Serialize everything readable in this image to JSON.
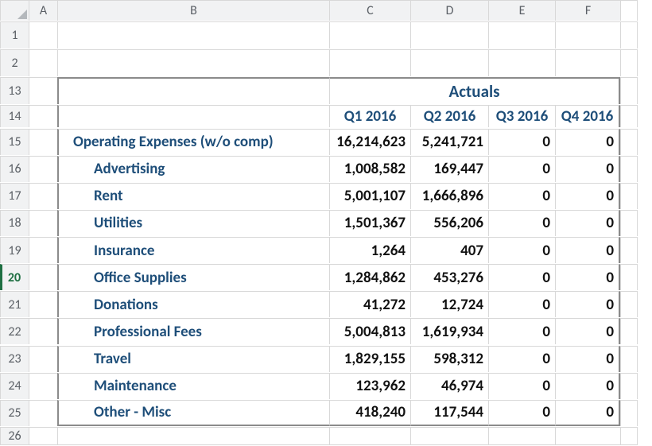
{
  "columns": [
    "A",
    "B",
    "C",
    "D",
    "E",
    "F"
  ],
  "rowNumbers": [
    "1",
    "2",
    "13",
    "14",
    "15",
    "16",
    "17",
    "18",
    "19",
    "20",
    "21",
    "22",
    "23",
    "24",
    "25",
    "26"
  ],
  "activeRow": "20",
  "header": {
    "section": "Actuals",
    "quarters": [
      "Q1 2016",
      "Q2 2016",
      "Q3 2016",
      "Q4 2016"
    ]
  },
  "group": {
    "title": "Operating Expenses (w/o comp)",
    "totals": [
      "16,214,623",
      "5,241,721",
      "0",
      "0"
    ]
  },
  "rows": [
    {
      "label": "Advertising",
      "v": [
        "1,008,582",
        "169,447",
        "0",
        "0"
      ]
    },
    {
      "label": "Rent",
      "v": [
        "5,001,107",
        "1,666,896",
        "0",
        "0"
      ]
    },
    {
      "label": "Utilities",
      "v": [
        "1,501,367",
        "556,206",
        "0",
        "0"
      ]
    },
    {
      "label": "Insurance",
      "v": [
        "1,264",
        "407",
        "0",
        "0"
      ]
    },
    {
      "label": "Office Supplies",
      "v": [
        "1,284,862",
        "453,276",
        "0",
        "0"
      ]
    },
    {
      "label": "Donations",
      "v": [
        "41,272",
        "12,724",
        "0",
        "0"
      ]
    },
    {
      "label": "Professional Fees",
      "v": [
        "5,004,813",
        "1,619,934",
        "0",
        "0"
      ]
    },
    {
      "label": "Travel",
      "v": [
        "1,829,155",
        "598,312",
        "0",
        "0"
      ]
    },
    {
      "label": "Maintenance",
      "v": [
        "123,962",
        "46,974",
        "0",
        "0"
      ]
    },
    {
      "label": "Other - Misc",
      "v": [
        "418,240",
        "117,544",
        "0",
        "0"
      ]
    }
  ],
  "chart_data": {
    "type": "table",
    "title": "Actuals — Operating Expenses (w/o comp)",
    "categories": [
      "Q1 2016",
      "Q2 2016",
      "Q3 2016",
      "Q4 2016"
    ],
    "series": [
      {
        "name": "Operating Expenses (w/o comp)",
        "values": [
          16214623,
          5241721,
          0,
          0
        ]
      },
      {
        "name": "Advertising",
        "values": [
          1008582,
          169447,
          0,
          0
        ]
      },
      {
        "name": "Rent",
        "values": [
          5001107,
          1666896,
          0,
          0
        ]
      },
      {
        "name": "Utilities",
        "values": [
          1501367,
          556206,
          0,
          0
        ]
      },
      {
        "name": "Insurance",
        "values": [
          1264,
          407,
          0,
          0
        ]
      },
      {
        "name": "Office Supplies",
        "values": [
          1284862,
          453276,
          0,
          0
        ]
      },
      {
        "name": "Donations",
        "values": [
          41272,
          12724,
          0,
          0
        ]
      },
      {
        "name": "Professional Fees",
        "values": [
          5004813,
          1619934,
          0,
          0
        ]
      },
      {
        "name": "Travel",
        "values": [
          1829155,
          598312,
          0,
          0
        ]
      },
      {
        "name": "Maintenance",
        "values": [
          123962,
          46974,
          0,
          0
        ]
      },
      {
        "name": "Other - Misc",
        "values": [
          418240,
          117544,
          0,
          0
        ]
      }
    ]
  }
}
